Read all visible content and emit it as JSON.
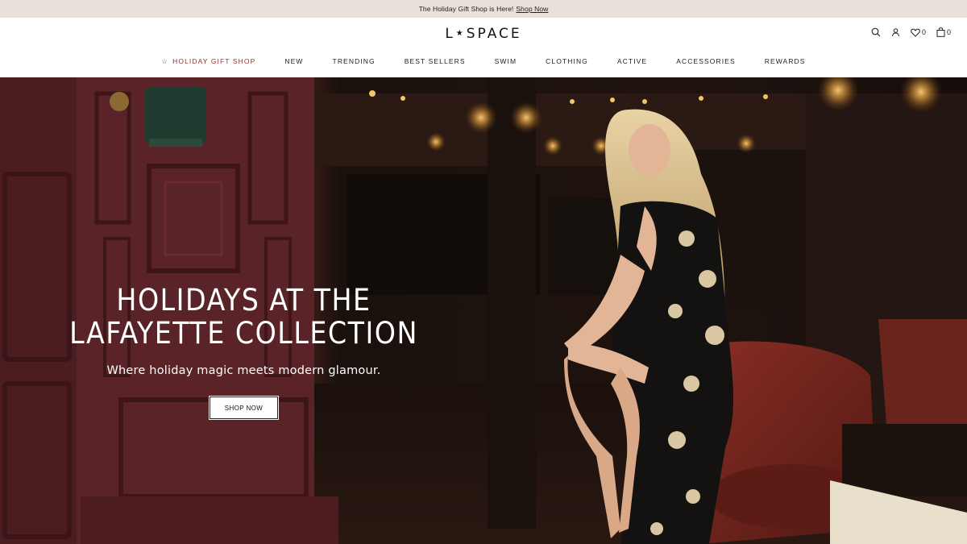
{
  "announcement": {
    "text": "The Holiday Gift Shop is Here!",
    "link_label": "Shop Now"
  },
  "header": {
    "logo_left": "L",
    "logo_star": "★",
    "logo_right": "SPACE",
    "wishlist_count": "0",
    "cart_count": "0",
    "icons": [
      "search-icon",
      "account-icon",
      "heart-icon",
      "bag-icon"
    ]
  },
  "nav": {
    "items": [
      {
        "label": "HOLIDAY GIFT SHOP",
        "icon": "☆"
      },
      {
        "label": "NEW"
      },
      {
        "label": "TRENDING"
      },
      {
        "label": "BEST SELLERS"
      },
      {
        "label": "SWIM"
      },
      {
        "label": "CLOTHING"
      },
      {
        "label": "ACTIVE"
      },
      {
        "label": "ACCESSORIES"
      },
      {
        "label": "REWARDS"
      }
    ]
  },
  "hero": {
    "title_line1": "HOLIDAYS AT THE",
    "title_line2": "LAFAYETTE COLLECTION",
    "subtitle": "Where holiday magic meets modern glamour.",
    "button_label": "SHOP NOW"
  },
  "colors": {
    "announcement_bg": "#e7e0db",
    "holiday_accent": "#9a2f2f",
    "hero_dark": "#1d120e"
  }
}
